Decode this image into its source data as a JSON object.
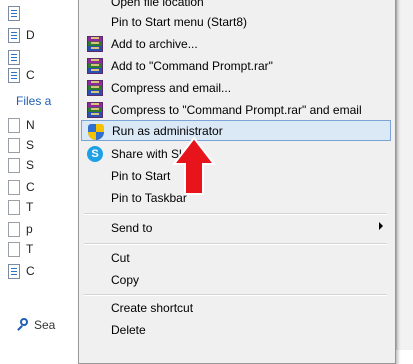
{
  "background": {
    "file_chars": [
      "",
      "D",
      "",
      "C"
    ],
    "files_header": "Files a",
    "list_chars": [
      "N",
      "S",
      "S",
      "C",
      "T",
      "p",
      "T",
      "C"
    ],
    "search_label": "Sea"
  },
  "menu": {
    "top_partial": "Open file location",
    "items": [
      {
        "label": "Pin to Start menu (Start8)"
      },
      {
        "label": "Add to archive...",
        "icon": "winrar-icon"
      },
      {
        "label": "Add to \"Command Prompt.rar\"",
        "icon": "winrar-icon"
      },
      {
        "label": "Compress and email...",
        "icon": "winrar-icon"
      },
      {
        "label": "Compress to \"Command Prompt.rar\" and email",
        "icon": "winrar-icon"
      },
      {
        "label": "Run as administrator",
        "icon": "uac-shield-icon",
        "highlighted": true
      },
      {
        "label": "Share with Skype",
        "icon": "skype-icon"
      },
      {
        "label": "Pin to Start"
      },
      {
        "label": "Pin to Taskbar"
      },
      {
        "label": "Send to",
        "submenu": true
      },
      {
        "label": "Cut"
      },
      {
        "label": "Copy"
      },
      {
        "label": "Create shortcut"
      },
      {
        "label": "Delete"
      }
    ]
  },
  "colors": {
    "highlight_bg": "#dbe8f6",
    "highlight_border": "#7aa3d6",
    "arrow": "#e8141c"
  }
}
